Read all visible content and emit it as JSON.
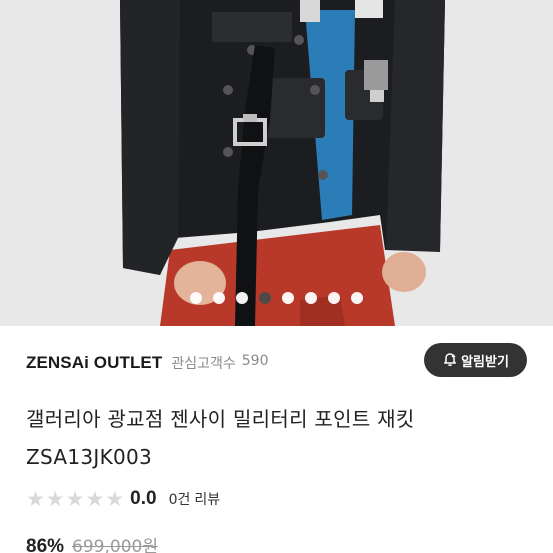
{
  "product_image": {
    "alt": "jacket-photo"
  },
  "carousel": {
    "total": 8,
    "active_index": 3
  },
  "seller": {
    "name": "ZENSAi OUTLET",
    "fans_label": "관심고객수",
    "fans_count": "590",
    "notify_label": "알림받기"
  },
  "product": {
    "title_line1": "갤러리아 광교점 젠사이 밀리터리 포인트 재킷",
    "title_line2": "ZSA13JK003"
  },
  "rating": {
    "score": "0.0",
    "review_count": "0건",
    "review_label": "리뷰",
    "stars_filled": 0,
    "stars_total": 5
  },
  "price": {
    "discount": "86%",
    "original": "699,000원"
  },
  "colors": {
    "notify_bg": "#333333",
    "star_empty": "#d9d9d9",
    "active_dot": "#4a4a4a"
  }
}
